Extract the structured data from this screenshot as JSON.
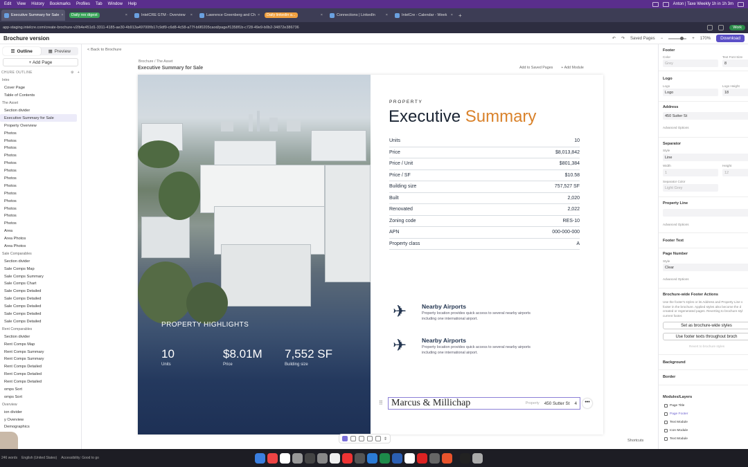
{
  "menubar": {
    "items": [
      "Edit",
      "View",
      "History",
      "Bookmarks",
      "Profiles",
      "Tab",
      "Window",
      "Help"
    ],
    "right_text": "Anton | Taxe Weekly 1h in 1h 3m"
  },
  "tabs": [
    {
      "label": "Executive Summary for Sale",
      "active": true
    },
    {
      "label": "Daily rex digest",
      "pill": true
    },
    {
      "label": "IntelCRE GTM - Overview"
    },
    {
      "label": "Lawrence Greenberg and Ch"
    },
    {
      "label": "Daily linkedin a...",
      "pill": true,
      "pill_color": "#f0a040"
    },
    {
      "label": "Connections | LinkedIn"
    },
    {
      "label": "IntelCre - Calendar - Week"
    }
  ],
  "address": {
    "url": "app-staging.intelcre.com/create-brochure-v2/b4e451d1-3311-4185-ae30-4b913a49700f/b17c9df9-c6d8-4c58-a77f-b6f0205caod/page/f1358f1b-c728-49e9-b0b2-34872e386736",
    "profile": "Work"
  },
  "header": {
    "title": "Brochure version",
    "saved_pages": "Saved Pages",
    "zoom": "170%",
    "download": "Download"
  },
  "sidebar": {
    "tab_outline": "Outline",
    "tab_preview": "Preview",
    "add_page": "+ Add Page",
    "outline_heading": "CHURE OUTLINE",
    "items": [
      {
        "label": "Intro",
        "group": true
      },
      {
        "label": "Cover Page"
      },
      {
        "label": "Table of Contents"
      },
      {
        "label": "The Asset",
        "group": true
      },
      {
        "label": "Section divider"
      },
      {
        "label": "Executive Summary for Sale",
        "selected": true
      },
      {
        "label": "Property Overview"
      },
      {
        "label": "Photos"
      },
      {
        "label": "Photos"
      },
      {
        "label": "Photos"
      },
      {
        "label": "Photos"
      },
      {
        "label": "Photos"
      },
      {
        "label": "Photos"
      },
      {
        "label": "Photos"
      },
      {
        "label": "Photos"
      },
      {
        "label": "Photos"
      },
      {
        "label": "Photos"
      },
      {
        "label": "Photos"
      },
      {
        "label": "Photos"
      },
      {
        "label": "Photos"
      },
      {
        "label": "Area"
      },
      {
        "label": "Area Photos"
      },
      {
        "label": "Area Photos"
      },
      {
        "label": "Sale Comparables",
        "group": true
      },
      {
        "label": "Section divider"
      },
      {
        "label": "Sale Comps Map"
      },
      {
        "label": "Sale Comps Summary"
      },
      {
        "label": "Sale Comps Chart"
      },
      {
        "label": "Sale Comps Detailed"
      },
      {
        "label": "Sale Comps Detailed"
      },
      {
        "label": "Sale Comps Detailed"
      },
      {
        "label": "Sale Comps Detailed"
      },
      {
        "label": "Sale Comps Detailed"
      },
      {
        "label": "Rent Comparables",
        "group": true
      },
      {
        "label": "Section divider"
      },
      {
        "label": "Rent Comps Map"
      },
      {
        "label": "Rent Comps Summary"
      },
      {
        "label": "Rent Comps Summary"
      },
      {
        "label": "Rent Comps Detailed"
      },
      {
        "label": "Rent Comps Detailed"
      },
      {
        "label": "Rent Comps Detailed"
      },
      {
        "label": "omps Sort"
      },
      {
        "label": "omps Sort"
      },
      {
        "label": "Overview",
        "group": true
      },
      {
        "label": "ion divider"
      },
      {
        "label": "y Overview"
      },
      {
        "label": "Demographics"
      }
    ]
  },
  "canvas": {
    "back": "< Back to Brochure",
    "breadcrumb": "Brochure  /  The Asset",
    "page_title": "Executive Summary for Sale",
    "add_saved": "Add to Saved Pages",
    "add_module": "+ Add Module",
    "shortcuts": "Shortcuts"
  },
  "page": {
    "highlights_label": "PROPERTY HIGHLIGHTS",
    "stats": [
      {
        "value": "10",
        "label": "Units"
      },
      {
        "value": "$8.01M",
        "label": "Price"
      },
      {
        "value": "7,552 SF",
        "label": "Building size"
      }
    ],
    "property_label": "PROPERTY",
    "title_main": "Executive",
    "title_accent": "Summary",
    "accent_color": "#d9822b",
    "facts": [
      {
        "k": "Units",
        "v": "10"
      },
      {
        "k": "Price",
        "v": "$8,013,842"
      },
      {
        "k": "Price / Unit",
        "v": "$801,384"
      },
      {
        "k": "Price / SF",
        "v": "$10.58"
      },
      {
        "k": "Building size",
        "v": "757,527 SF"
      },
      {
        "k": "Built",
        "v": "2,020"
      },
      {
        "k": "Renovated",
        "v": "2,022"
      },
      {
        "k": "Zoning code",
        "v": "RES-10"
      },
      {
        "k": "APN",
        "v": "000-000-000"
      },
      {
        "k": "Property class",
        "v": "A"
      }
    ],
    "airports": [
      {
        "title": "Nearby Airports",
        "desc": "Property location provides quick access to several nearby airports including one international airport."
      },
      {
        "title": "Nearby Airports",
        "desc": "Property location provides quick access to several nearby airports including one international airport."
      }
    ],
    "footer": {
      "logo": "Marcus & Millichap",
      "property": "Property",
      "address": "450 Sutter St",
      "page_no": "4"
    }
  },
  "inspector": {
    "beta": "Beta",
    "footer_h": "Footer",
    "color_l": "Color",
    "color_v": "Grey",
    "text_size_l": "Text Font Size",
    "text_size_v": "8",
    "logo_h": "Logo",
    "logo_l": "Logo",
    "logo_v": "Logo",
    "logo_height_l": "Logo Height",
    "logo_height_v": "18",
    "address_h": "Address",
    "address_v": "450 Sutter St",
    "adv1": "Advanced Options",
    "separator_h": "Separator",
    "style_l": "Style",
    "style_v": "Line",
    "width_l": "Width",
    "width_v": "1",
    "height_l": "Height",
    "height_v": "12",
    "sepcolor_l": "Separator Color",
    "sepcolor_v": "Light Grey",
    "propline_h": "Property Line",
    "adv2": "Advanced Options",
    "footertext_h": "Footer Text",
    "pagenum_h": "Page Number",
    "pn_style_l": "Style",
    "pn_style_v": "Clear",
    "adv3": "Advanced Options",
    "bw_h": "Brochure-wide Footer Actions",
    "bw_desc": "Use the footer's styles or its Address and Property Line v footer in the brochure. Applied styles also become the d created or regenerated pages. Reverting to brochure styl current footer.",
    "btn_set": "Set as brochure-wide styles",
    "btn_use": "Use footer texts throughout broch",
    "revert": "Revert to brochure styles",
    "background_h": "Background",
    "border_h": "Border",
    "layers_h": "Modules/Layers",
    "layers": [
      "Page Title",
      "Page Footer",
      "Text Module",
      "Icon Module",
      "Text Module"
    ]
  },
  "statusbar": {
    "words": "246 words",
    "lang": "English (United States)",
    "access": "Accessibility: Good to go"
  }
}
